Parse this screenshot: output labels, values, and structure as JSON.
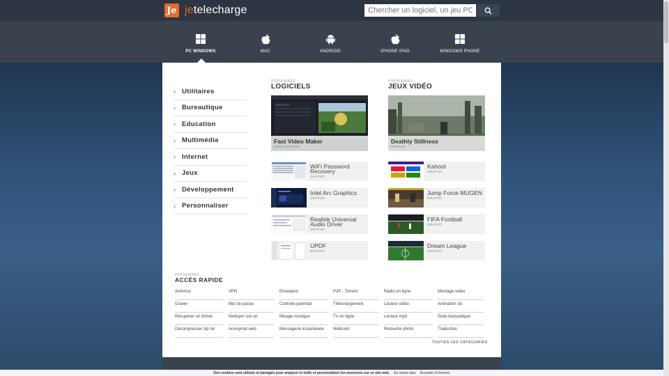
{
  "header": {
    "logo_mark": "Je",
    "logo_prefix": "je",
    "logo_suffix": "telecharge",
    "search_placeholder": "Chercher un logiciel, un jeu PC"
  },
  "catnav": [
    {
      "label": "PC WINDOWS",
      "icon": "windows-icon",
      "active": true
    },
    {
      "label": "MAC",
      "icon": "apple-icon",
      "active": false
    },
    {
      "label": "ANDROID",
      "icon": "android-icon",
      "active": false
    },
    {
      "label": "IPHONE IPAD",
      "icon": "apple-icon",
      "active": false
    },
    {
      "label": "WINDOWS PHONE",
      "icon": "windows-icon",
      "active": false
    }
  ],
  "categories": [
    "Utilitaires",
    "Bureautique",
    "Education",
    "Multimédia",
    "Internet",
    "Jeux",
    "Développement",
    "Personnaliser"
  ],
  "software": {
    "kicker": "POPULAIRES",
    "title": "LOGICIELS",
    "featured": {
      "name": "Fast Video Maker",
      "license": "ESSAI GRATUIT"
    },
    "items": [
      {
        "name": "WiFi Password Recovery",
        "license": "GRATUIT"
      },
      {
        "name": "Intel Arc Graphics",
        "license": "GRATUIT"
      },
      {
        "name": "Realtek Universal Audio Driver",
        "license": "GRATUIT"
      },
      {
        "name": "UPDF",
        "license": "GRATUIT"
      }
    ]
  },
  "games": {
    "kicker": "POPULAIRES",
    "title": "JEUX VIDÉO",
    "featured": {
      "name": "Deathly Stillness",
      "license": "GRATUIT"
    },
    "items": [
      {
        "name": "Kahoot",
        "license": "GRATUIT"
      },
      {
        "name": "Jump Force MUGEN",
        "license": "GRATUIT"
      },
      {
        "name": "FIFA Football",
        "license": "GRATUIT"
      },
      {
        "name": "Dream League",
        "license": "GRATUIT"
      }
    ]
  },
  "quick_access": {
    "kicker": "POPULAIRES",
    "title": "ACCÈS RAPIDE",
    "rows": [
      [
        "Antivirus",
        "VPN",
        "Emulateur",
        "P2P - Torrent",
        "Radio en ligne",
        "Montage vidéo"
      ],
      [
        "Graver",
        "Mot de passe",
        "Contrôle parental",
        "Téléchargement",
        "Lecteur vidéo",
        "Animation 3d"
      ],
      [
        "Récupérer un fichier",
        "Nettoyer son pc",
        "Mixage musique",
        "TV en ligne",
        "Lecteur mp3",
        "Suite bureautique"
      ],
      [
        "Décompresser zip rar",
        "Anonymat web",
        "Messagerie instantanée",
        "Webcam",
        "Retouche photo",
        "Traduction"
      ]
    ],
    "all_link": "TOUTES LES CATÉGORIES"
  },
  "cookie": {
    "message": "Des cookies sont utilisés et partagés pour analyser le trafic et personnaliser les annonces sur ce site web.",
    "learn_more": "En savoir plus",
    "accept": "Accepter et Fermer"
  },
  "colors": {
    "accent": "#e46a2e",
    "header": "#2c3541",
    "nav": "#3a424d",
    "license": "#4a9a4a"
  }
}
